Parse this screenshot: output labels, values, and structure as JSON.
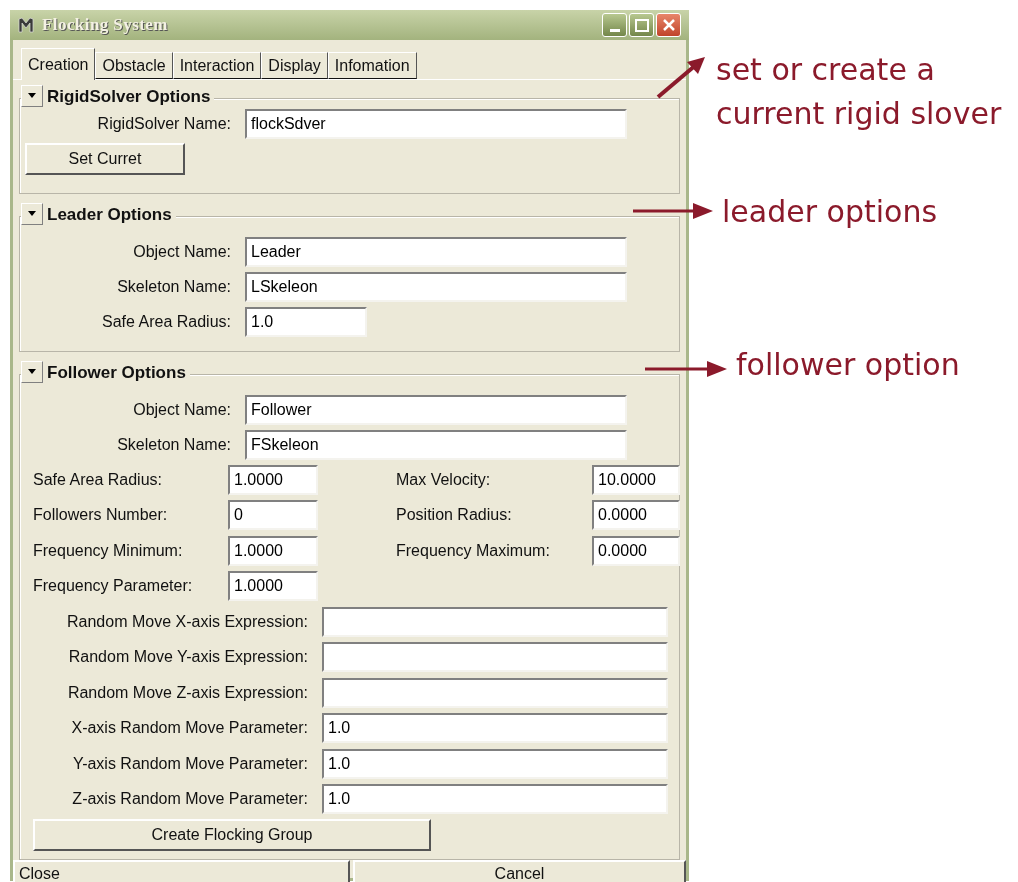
{
  "window": {
    "title": "Flocking System"
  },
  "tabs": [
    {
      "label": "Creation",
      "selected": true
    },
    {
      "label": "Obstacle",
      "selected": false
    },
    {
      "label": "Interaction",
      "selected": false
    },
    {
      "label": "Display",
      "selected": false
    },
    {
      "label": "Infomation",
      "selected": false
    }
  ],
  "rigid_solver": {
    "title": "RigidSolver Options",
    "expanded": true,
    "fields": [
      {
        "label": "RigidSolver Name:",
        "value": "flockSdver",
        "kind": "wide"
      }
    ],
    "button": "Set Curret"
  },
  "leader": {
    "title": "Leader Options",
    "expanded": true,
    "fields": [
      {
        "label": "Object Name:",
        "value": "Leader",
        "kind": "wide"
      },
      {
        "label": "Skeleton Name:",
        "value": "LSkeleon",
        "kind": "wide"
      },
      {
        "label": "Safe Area Radius:",
        "value": "1.0",
        "kind": "short"
      }
    ]
  },
  "follower": {
    "title": "Follower Options",
    "expanded": true,
    "fields": [
      {
        "label": "Object Name:",
        "value": "Follower",
        "kind": "wide"
      },
      {
        "label": "Skeleton Name:",
        "value": "FSkeleon",
        "kind": "wide"
      }
    ],
    "pairs": [
      [
        {
          "label": "Safe Area Radius:",
          "value": "1.0000"
        },
        {
          "label": "Max Velocity:",
          "value": "10.0000"
        }
      ],
      [
        {
          "label": "Followers Number:",
          "value": "0"
        },
        {
          "label": "Position Radius:",
          "value": "0.0000"
        }
      ],
      [
        {
          "label": "Frequency Minimum:",
          "value": "1.0000"
        },
        {
          "label": "Frequency Maximum:",
          "value": "0.0000"
        }
      ],
      [
        {
          "label": "Frequency Parameter:",
          "value": "1.0000"
        }
      ]
    ],
    "expressions": [
      {
        "label": "Random Move X-axis Expression:"
      },
      {
        "label": "Random Move Y-axis Expression:"
      },
      {
        "label": "Random Move Z-axis Expression:"
      },
      {
        "label": "X-axis Random Move Parameter:",
        "value": "1.0"
      },
      {
        "label": "Y-axis Random Move Parameter:",
        "value": "1.0"
      },
      {
        "label": "Z-axis Random Move Parameter:",
        "value": "1.0"
      }
    ],
    "button": "Create Flocking Group"
  },
  "footer_buttons": [
    "Close",
    "Cancel"
  ],
  "annotations": [
    {
      "lines": [
        "set or create a",
        "current rigid slover"
      ]
    },
    {
      "lines": [
        "leader options"
      ]
    },
    {
      "lines": [
        "follower option"
      ]
    }
  ]
}
